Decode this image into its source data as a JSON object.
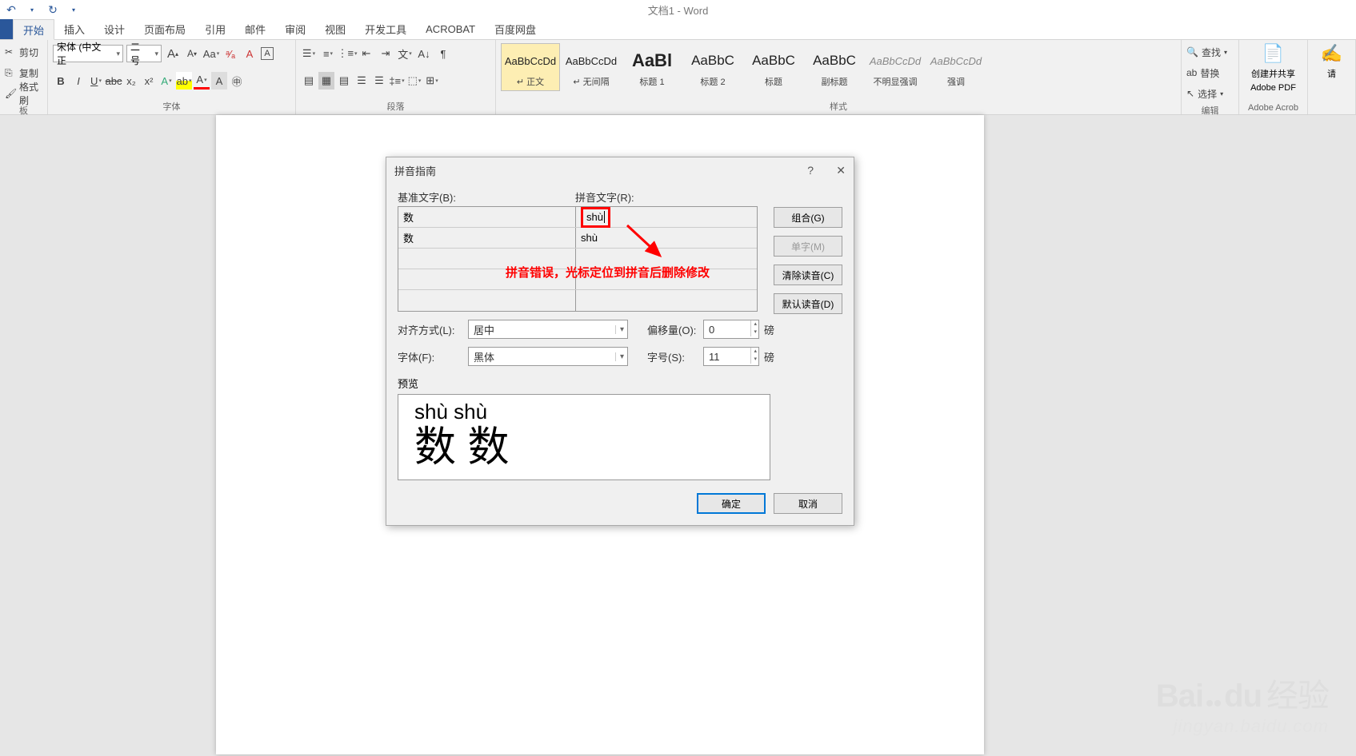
{
  "title": "文档1 - Word",
  "qat": {
    "save_icon": "↶",
    "redo": "↷",
    "dropdown": "▾"
  },
  "tabs": [
    "开始",
    "插入",
    "设计",
    "页面布局",
    "引用",
    "邮件",
    "审阅",
    "视图",
    "开发工具",
    "ACROBAT",
    "百度网盘"
  ],
  "ribbon": {
    "clipboard": {
      "cut": "剪切",
      "copy": "复制",
      "format": "格式刷",
      "label": "板"
    },
    "font": {
      "name": "宋体 (中文正",
      "size": "二号",
      "label": "字体"
    },
    "paragraph": {
      "label": "段落"
    },
    "styles": {
      "label": "样式",
      "items": [
        {
          "preview": "AaBbCcDd",
          "name": "↵ 正文",
          "sel": true
        },
        {
          "preview": "AaBbCcDd",
          "name": "↵ 无间隔"
        },
        {
          "preview": "AaBl",
          "name": "标题 1",
          "bold": true,
          "size": "22px"
        },
        {
          "preview": "AaBbC",
          "name": "标题 2",
          "size": "17px"
        },
        {
          "preview": "AaBbC",
          "name": "标题",
          "size": "17px"
        },
        {
          "preview": "AaBbC",
          "name": "副标题",
          "size": "17px"
        },
        {
          "preview": "AaBbCcDd",
          "name": "不明显强调",
          "italic": true,
          "color": "#888"
        },
        {
          "preview": "AaBbCcDd",
          "name": "强调",
          "italic": true,
          "color": "#888"
        }
      ]
    },
    "editing": {
      "find": "查找",
      "replace": "替换",
      "select": "选择",
      "label": "编辑"
    },
    "adobe": {
      "btn": "创建并共享",
      "btn2": "Adobe PDF",
      "label": "Adobe Acrob"
    },
    "sign": "请"
  },
  "dialog": {
    "title": "拼音指南",
    "base_label": "基准文字(B):",
    "ruby_label": "拼音文字(R):",
    "rows": [
      {
        "base": "数",
        "ruby": "shù"
      },
      {
        "base": "数",
        "ruby": "shù"
      },
      {
        "base": "",
        "ruby": ""
      },
      {
        "base": "",
        "ruby": ""
      },
      {
        "base": "",
        "ruby": ""
      }
    ],
    "btn_group": "组合(G)",
    "btn_single": "单字(M)",
    "btn_clear": "清除读音(C)",
    "btn_default": "默认读音(D)",
    "align_label": "对齐方式(L):",
    "align_value": "居中",
    "offset_label": "偏移量(O):",
    "offset_value": "0",
    "offset_unit": "磅",
    "font_label": "字体(F):",
    "font_value": "黑体",
    "size_label": "字号(S):",
    "size_value": "11",
    "size_unit": "磅",
    "preview_label": "预览",
    "preview_ruby": "shù  shù",
    "preview_base": "数 数",
    "ok": "确定",
    "cancel": "取消"
  },
  "annotation": "拼音错误，光标定位到拼音后删除修改",
  "watermark": {
    "main": "Bai",
    "main2": "du",
    "main3": "经验",
    "sub": "jingyan.baidu.com"
  }
}
